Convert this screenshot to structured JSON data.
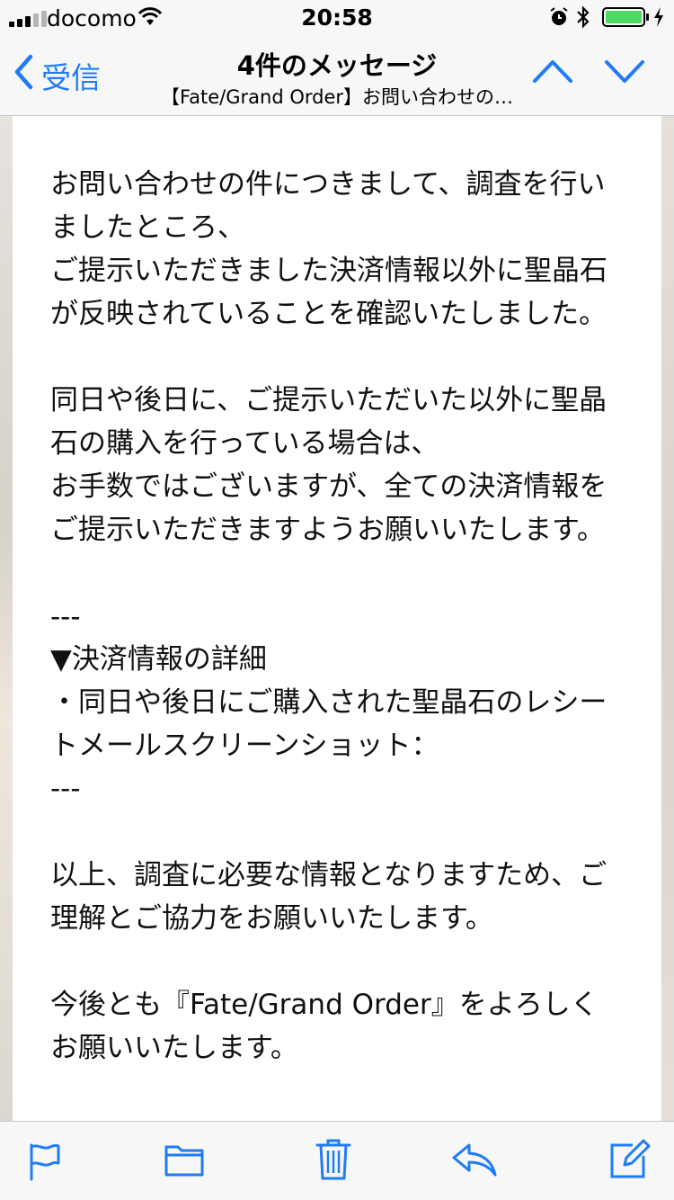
{
  "status_bar": {
    "carrier": "docomo",
    "time": "20:58",
    "battery_level": 1.0
  },
  "nav": {
    "back_label": "受信",
    "title": "4件のメッセージ",
    "subtitle": "【Fate/Grand Order】お問い合わせの…"
  },
  "message": {
    "lines": [
      "お問い合わせの件につきまして、調査を行い",
      "ましたところ、",
      "ご提示いただきました決済情報以外に聖晶石",
      "が反映されていることを確認いたしました。",
      "同日や後日に、ご提示いただいた以外に聖晶",
      "石の購入を行っている場合は、",
      "お手数ではございますが、全ての決済情報を",
      "ご提示いただきますようお願いいたします。",
      "---",
      "▼決済情報の詳細",
      "・同日や後日にご購入された聖晶石のレシー",
      "トメールスクリーンショット：",
      "---",
      "以上、調査に必要な情報となりますため、ご",
      "理解とご協力をお願いいたします。",
      "今後とも『Fate/Grand Order』をよろしく",
      "お願いいたします。"
    ]
  },
  "colors": {
    "accent": "#1f7cf6",
    "battery": "#4cd964"
  },
  "toolbar": {
    "icons": [
      "flag-icon",
      "folder-icon",
      "trash-icon",
      "reply-icon",
      "compose-icon"
    ]
  }
}
